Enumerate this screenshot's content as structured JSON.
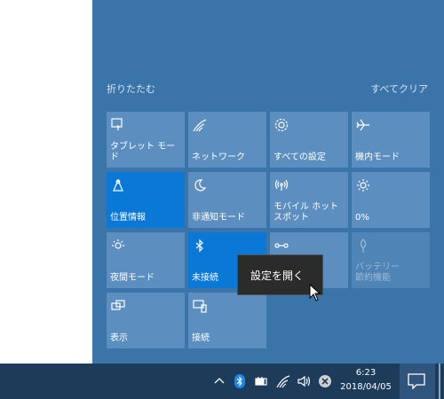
{
  "action_center": {
    "collapse_label": "折りたたむ",
    "clear_all_label": "すべてクリア",
    "tiles": [
      {
        "label": "タブレット モード",
        "icon": "tablet-mode-icon",
        "state": "off"
      },
      {
        "label": "ネットワーク",
        "icon": "network-icon",
        "state": "off"
      },
      {
        "label": "すべての設定",
        "icon": "gear-icon",
        "state": "off"
      },
      {
        "label": "機内モード",
        "icon": "airplane-icon",
        "state": "off"
      },
      {
        "label": "位置情報",
        "icon": "location-icon",
        "state": "on"
      },
      {
        "label": "非通知モード",
        "icon": "moon-icon",
        "state": "off"
      },
      {
        "label": "モバイル ホットスポット",
        "icon": "hotspot-icon",
        "state": "off"
      },
      {
        "label": "0%",
        "icon": "brightness-icon",
        "state": "off"
      },
      {
        "label": "夜間モード",
        "icon": "night-light-icon",
        "state": "off"
      },
      {
        "label": "未接続",
        "icon": "bluetooth-icon",
        "state": "on"
      },
      {
        "label": "",
        "icon": "vpn-icon",
        "state": "off"
      },
      {
        "label": "バッテリー\n節約機能",
        "icon": "battery-saver-icon",
        "state": "disabled"
      },
      {
        "label": "表示",
        "icon": "project-icon",
        "state": "off"
      },
      {
        "label": "接続",
        "icon": "connect-icon",
        "state": "off"
      }
    ]
  },
  "tooltip": {
    "text": "設定を開く"
  },
  "taskbar": {
    "time": "6:23",
    "date": "2018/04/05",
    "tray_icons": [
      "chevron-up-icon",
      "bluetooth-icon",
      "battery-icon",
      "wifi-icon",
      "volume-icon",
      "close-circle-icon"
    ]
  },
  "colors": {
    "accent": "#0a78d7",
    "tile": "#5c8fc0",
    "panel": "#3a74a9",
    "taskbar": "#1c3c5a"
  }
}
